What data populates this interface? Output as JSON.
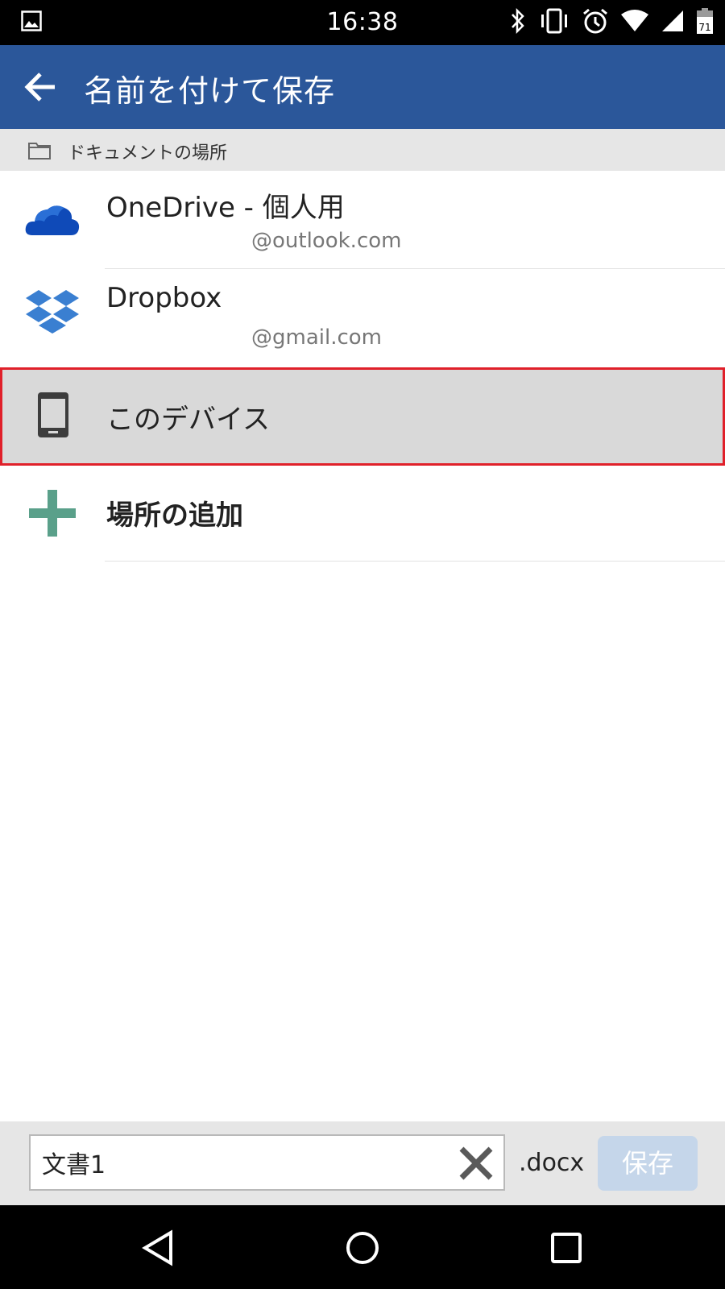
{
  "status_bar": {
    "time": "16:38",
    "icons": [
      "gallery-icon",
      "bluetooth-icon",
      "vibrate-icon",
      "alarm-icon",
      "wifi-icon",
      "signal-icon",
      "battery-icon"
    ],
    "battery": "71"
  },
  "app_bar": {
    "title": "名前を付けて保存",
    "accent_color": "#2b579a"
  },
  "section": {
    "label": "ドキュメントの場所"
  },
  "locations": [
    {
      "name": "OneDrive - 個人用",
      "account": "@outlook.com",
      "icon": "onedrive-icon"
    },
    {
      "name": "Dropbox",
      "account": "@gmail.com",
      "icon": "dropbox-icon"
    },
    {
      "name": "このデバイス",
      "icon": "phone-icon",
      "selected": true
    },
    {
      "name": "場所の追加",
      "icon": "plus-icon"
    }
  ],
  "bottom": {
    "filename": "文書1",
    "extension": ".docx",
    "save_label": "保存"
  },
  "nav": [
    "back-nav-icon",
    "home-nav-icon",
    "recents-nav-icon"
  ]
}
